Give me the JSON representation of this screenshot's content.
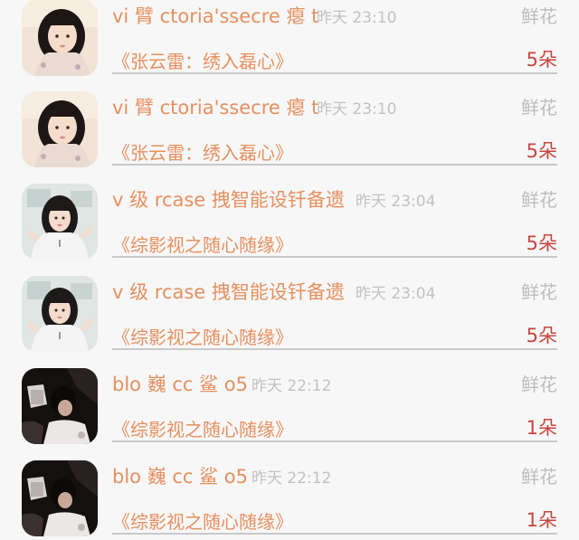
{
  "rows": [
    {
      "username": "vi 臂 ctoria'ssecre 瘪 t",
      "time": "昨天 23:10",
      "gift_type": "鲜花",
      "book_title": "《张云雷：绣入磊心》",
      "gift_count": "5朵",
      "avatar_kind": "girl-light"
    },
    {
      "username": "vi 臂 ctoria'ssecre 瘪 t",
      "time": "昨天 23:10",
      "gift_type": "鲜花",
      "book_title": "《张云雷：绣入磊心》",
      "gift_count": "5朵",
      "avatar_kind": "girl-light"
    },
    {
      "username": "v 级 rcase 拽智能设钎备遗",
      "time": "昨天 23:04",
      "gift_type": "鲜花",
      "book_title": "《综影视之随心随缘》",
      "gift_count": "5朵",
      "avatar_kind": "girl-white"
    },
    {
      "username": "v 级 rcase 拽智能设钎备遗",
      "time": "昨天 23:04",
      "gift_type": "鲜花",
      "book_title": "《综影视之随心随缘》",
      "gift_count": "5朵",
      "avatar_kind": "girl-white"
    },
    {
      "username": "blo 巍 cc 鲨 o5",
      "time": "昨天 22:12",
      "gift_type": "鲜花",
      "book_title": "《综影视之随心随缘》",
      "gift_count": "1朵",
      "avatar_kind": "dark"
    },
    {
      "username": "blo 巍 cc 鲨 o5",
      "time": "昨天 22:12",
      "gift_type": "鲜花",
      "book_title": "《综影视之随心随缘》",
      "gift_count": "1朵",
      "avatar_kind": "dark"
    }
  ]
}
